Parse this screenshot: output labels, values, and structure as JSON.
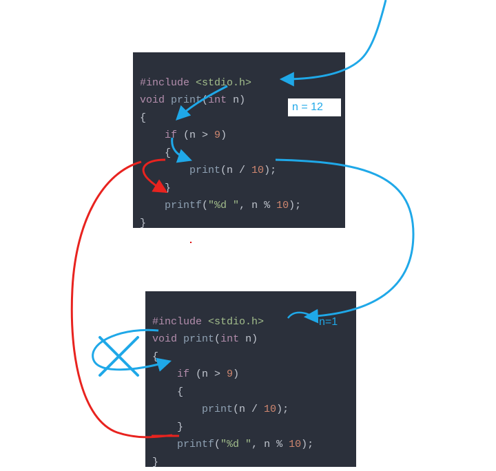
{
  "block1": {
    "line1_include": "#include",
    "line1_header": "<stdio.h>",
    "line2_void": "void",
    "line2_func": "print",
    "line2_lpar": "(",
    "line2_int": "int",
    "line2_param": " n",
    "line2_rpar": ")",
    "line3_brace": "{",
    "line4_indent": "    ",
    "line4_if": "if",
    "line4_cond": " (n > ",
    "line4_nine": "9",
    "line4_rpar": ")",
    "line5_indent": "    ",
    "line5_brace": "{",
    "line6_indent": "        ",
    "line6_call": "print",
    "line6_larg": "(n / ",
    "line6_ten": "10",
    "line6_end": ");",
    "line7_indent": "    ",
    "line7_brace": "}",
    "line8_indent": "    ",
    "line8_call": "printf",
    "line8_l": "(",
    "line8_fmt": "\"%d \"",
    "line8_mid": ", n % ",
    "line8_ten": "10",
    "line8_end": ");",
    "line9_brace": "}"
  },
  "block2": {
    "line1_include": "#include",
    "line1_header": "<stdio.h>",
    "line2_void": "void",
    "line2_func": "print",
    "line2_lpar": "(",
    "line2_int": "int",
    "line2_param": " n",
    "line2_rpar": ")",
    "line3_brace": "{",
    "line4_indent": "    ",
    "line4_if": "if",
    "line4_cond": " (n > ",
    "line4_nine": "9",
    "line4_rpar": ")",
    "line5_indent": "    ",
    "line5_brace": "{",
    "line6_indent": "        ",
    "line6_call": "print",
    "line6_larg": "(n / ",
    "line6_ten": "10",
    "line6_end": ");",
    "line7_indent": "    ",
    "line7_brace": "}",
    "line8_indent": "    ",
    "line8_call": "printf",
    "line8_l": "(",
    "line8_fmt": "\"%d \"",
    "line8_mid": ", n % ",
    "line8_ten": "10",
    "line8_end": ");",
    "line9_brace": "}"
  },
  "labels": {
    "n12": "n = 12",
    "n1": "n=1"
  },
  "arrows": {
    "blue": "#1fa8e8",
    "red": "#e8231f"
  }
}
